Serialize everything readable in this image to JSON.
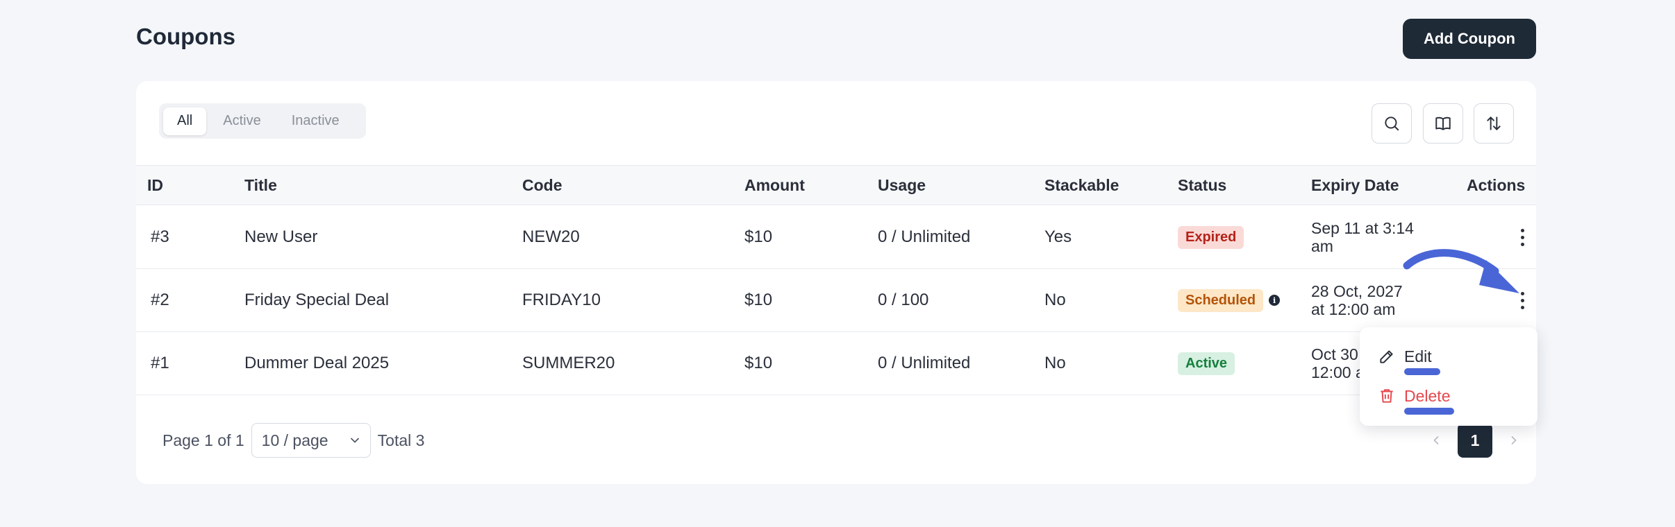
{
  "header": {
    "title": "Coupons",
    "add_button": "Add Coupon"
  },
  "filters": {
    "tabs": [
      "All",
      "Active",
      "Inactive"
    ],
    "active": "All"
  },
  "toolbar": {
    "icons": [
      "search-icon",
      "book-icon",
      "sort-icon"
    ]
  },
  "table": {
    "columns": {
      "id": "ID",
      "title": "Title",
      "code": "Code",
      "amount": "Amount",
      "usage": "Usage",
      "stackable": "Stackable",
      "status": "Status",
      "expiry": "Expiry Date",
      "actions": "Actions"
    },
    "rows": [
      {
        "id": "#3",
        "title": "New User",
        "code": "NEW20",
        "amount": "$10",
        "usage": "0 / Unlimited",
        "stackable": "Yes",
        "status": "Expired",
        "expiry_line1": "Sep 11 at 3:14",
        "expiry_line2": "am"
      },
      {
        "id": "#2",
        "title": "Friday Special Deal",
        "code": "FRIDAY10",
        "amount": "$10",
        "usage": "0 / 100",
        "stackable": "No",
        "status": "Scheduled",
        "expiry_line1": "28 Oct, 2027",
        "expiry_line2": "at 12:00 am"
      },
      {
        "id": "#1",
        "title": "Dummer Deal 2025",
        "code": "SUMMER20",
        "amount": "$10",
        "usage": "0 / Unlimited",
        "stackable": "No",
        "status": "Active",
        "expiry_line1": "Oct 30",
        "expiry_line2": "12:00 a"
      }
    ]
  },
  "pagination": {
    "page_info": "Page 1 of 1",
    "page_size": "10 / page",
    "total": "Total 3",
    "current_page": "1"
  },
  "action_menu": {
    "edit": "Edit",
    "delete": "Delete"
  },
  "colors": {
    "primary_dark": "#1f2a37",
    "expired": "#b42318",
    "scheduled": "#b45309",
    "active": "#15803d",
    "delete": "#e5484d",
    "annotation": "#4a66d6"
  }
}
